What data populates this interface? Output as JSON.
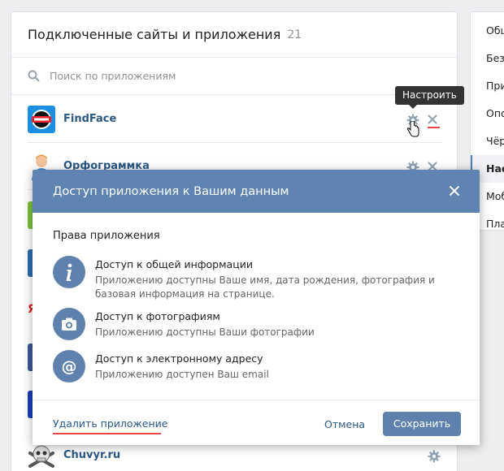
{
  "panel": {
    "title": "Подключенные сайты и приложения",
    "count": "21",
    "search_placeholder": "Поиск по приложениям"
  },
  "apps": [
    {
      "name": "FindFace",
      "icon": "findface-logo"
    },
    {
      "name": "Орфограммка",
      "icon": "orfogrammka-avatar"
    },
    {
      "name": "Chuvyr.ru",
      "icon": "skull-pirate-icon"
    }
  ],
  "partial_text": {
    "ya_letter": "Я"
  },
  "tooltip": {
    "text": "Настроить"
  },
  "right_menu": {
    "items": [
      "Общ",
      "Безо",
      "При",
      "Опо",
      "Чёр",
      "Нас",
      "Моб",
      "Пла"
    ],
    "active_index": 5
  },
  "modal": {
    "title": "Доступ приложения к Вашим данным",
    "section_title": "Права приложения",
    "permissions": [
      {
        "icon": "info-icon",
        "title": "Доступ к общей информации",
        "description": "Приложению доступны Ваше имя, дата рождения, фотография и базовая информация на странице."
      },
      {
        "icon": "camera-icon",
        "title": "Доступ к фотографиям",
        "description": "Приложению доступны Ваши фотографии"
      },
      {
        "icon": "at-sign-icon",
        "title": "Доступ к электронному адресу",
        "description": "Приложению доступен Ваш email"
      }
    ],
    "delete_label": "Удалить приложение",
    "cancel_label": "Отмена",
    "save_label": "Сохранить"
  },
  "colors": {
    "accent": "#5e82ad",
    "header": "#5f84b1",
    "link": "#2a5885",
    "highlight_red": "#e64646",
    "background": "#edeef0"
  }
}
